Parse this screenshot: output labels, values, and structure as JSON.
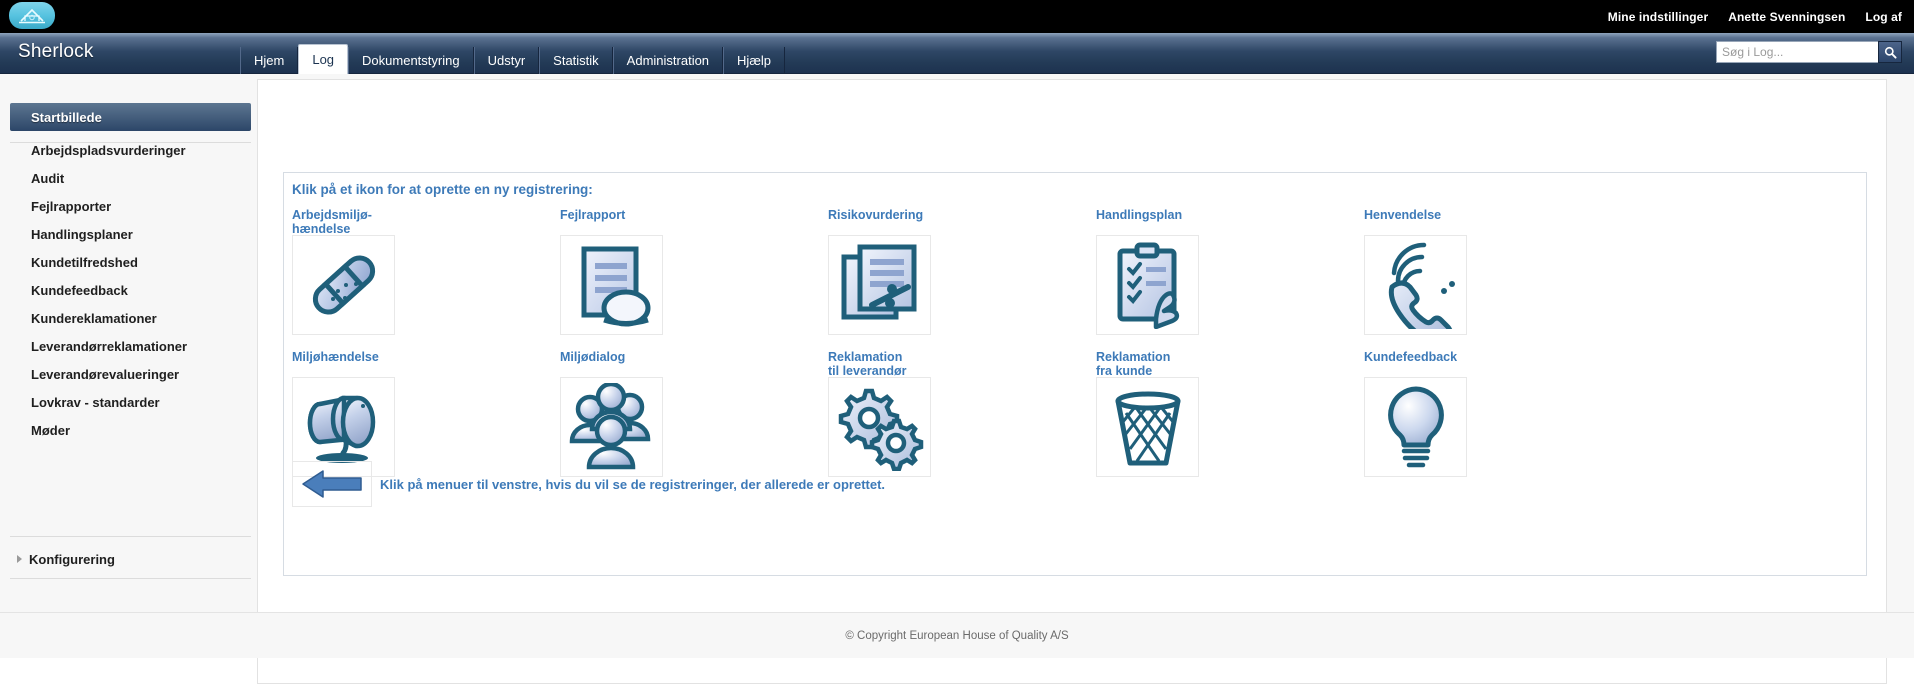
{
  "topbar": {
    "logo_icon": "cloud-house-logo-icon",
    "links": [
      {
        "label": "Mine indstillinger",
        "name": "my-settings-link"
      },
      {
        "label": "Anette Svenningsen",
        "name": "user-name-link"
      },
      {
        "label": "Log af",
        "name": "logout-link"
      }
    ]
  },
  "navbar": {
    "brand": "Sherlock",
    "tabs": [
      {
        "label": "Hjem",
        "active": false
      },
      {
        "label": "Log",
        "active": true
      },
      {
        "label": "Dokumentstyring",
        "active": false
      },
      {
        "label": "Udstyr",
        "active": false
      },
      {
        "label": "Statistik",
        "active": false
      },
      {
        "label": "Administration",
        "active": false
      },
      {
        "label": "Hjælp",
        "active": false
      }
    ],
    "search": {
      "placeholder": "Søg i Log...",
      "value": "",
      "button_icon": "search-icon"
    }
  },
  "sidebar": {
    "active_item": "Startbillede",
    "items": [
      "Arbejdspladsvurderinger",
      "Audit",
      "Fejlrapporter",
      "Handlingsplaner",
      "Kundetilfredshed",
      "Kundefeedback",
      "Kundereklamationer",
      "Leverandørreklamationer",
      "Leverandørevalueringer",
      "Lovkrav - standarder",
      "Møder"
    ],
    "config_label": "Konfigurering",
    "config_icon": "chevron-right-icon"
  },
  "main": {
    "panel_title": "Klik på et ikon for at oprette en ny registrering:",
    "tiles": [
      {
        "label": "Arbejdsmiljø-\nhændelse",
        "icon": "bandage-icon"
      },
      {
        "label": "Fejlrapport",
        "icon": "document-report-icon"
      },
      {
        "label": "Risikovurdering",
        "icon": "risk-documents-icon"
      },
      {
        "label": "Handlingsplan",
        "icon": "clipboard-checklist-icon"
      },
      {
        "label": "Henvendelse",
        "icon": "phone-ringing-icon"
      },
      {
        "label": "Miljøhændelse",
        "icon": "oil-barrels-icon"
      },
      {
        "label": "Miljødialog",
        "icon": "people-group-icon"
      },
      {
        "label": "Reklamation\ntil leverandør",
        "icon": "gears-icon"
      },
      {
        "label": "Reklamation\nfra kunde",
        "icon": "waste-basket-icon"
      },
      {
        "label": "Kundefeedback",
        "icon": "lightbulb-icon"
      }
    ],
    "hint": {
      "icon": "arrow-left-icon",
      "text": "Klik på menuer til venstre, hvis du vil se de registreringer, der allerede er oprettet."
    }
  },
  "footer": {
    "copyright": "© Copyright European House of Quality A/S"
  },
  "colors": {
    "accent_blue": "#3d7ab8",
    "nav_dark": "#233a56",
    "icon_outline": "#1f5f7a",
    "icon_fill": "#aebede"
  }
}
